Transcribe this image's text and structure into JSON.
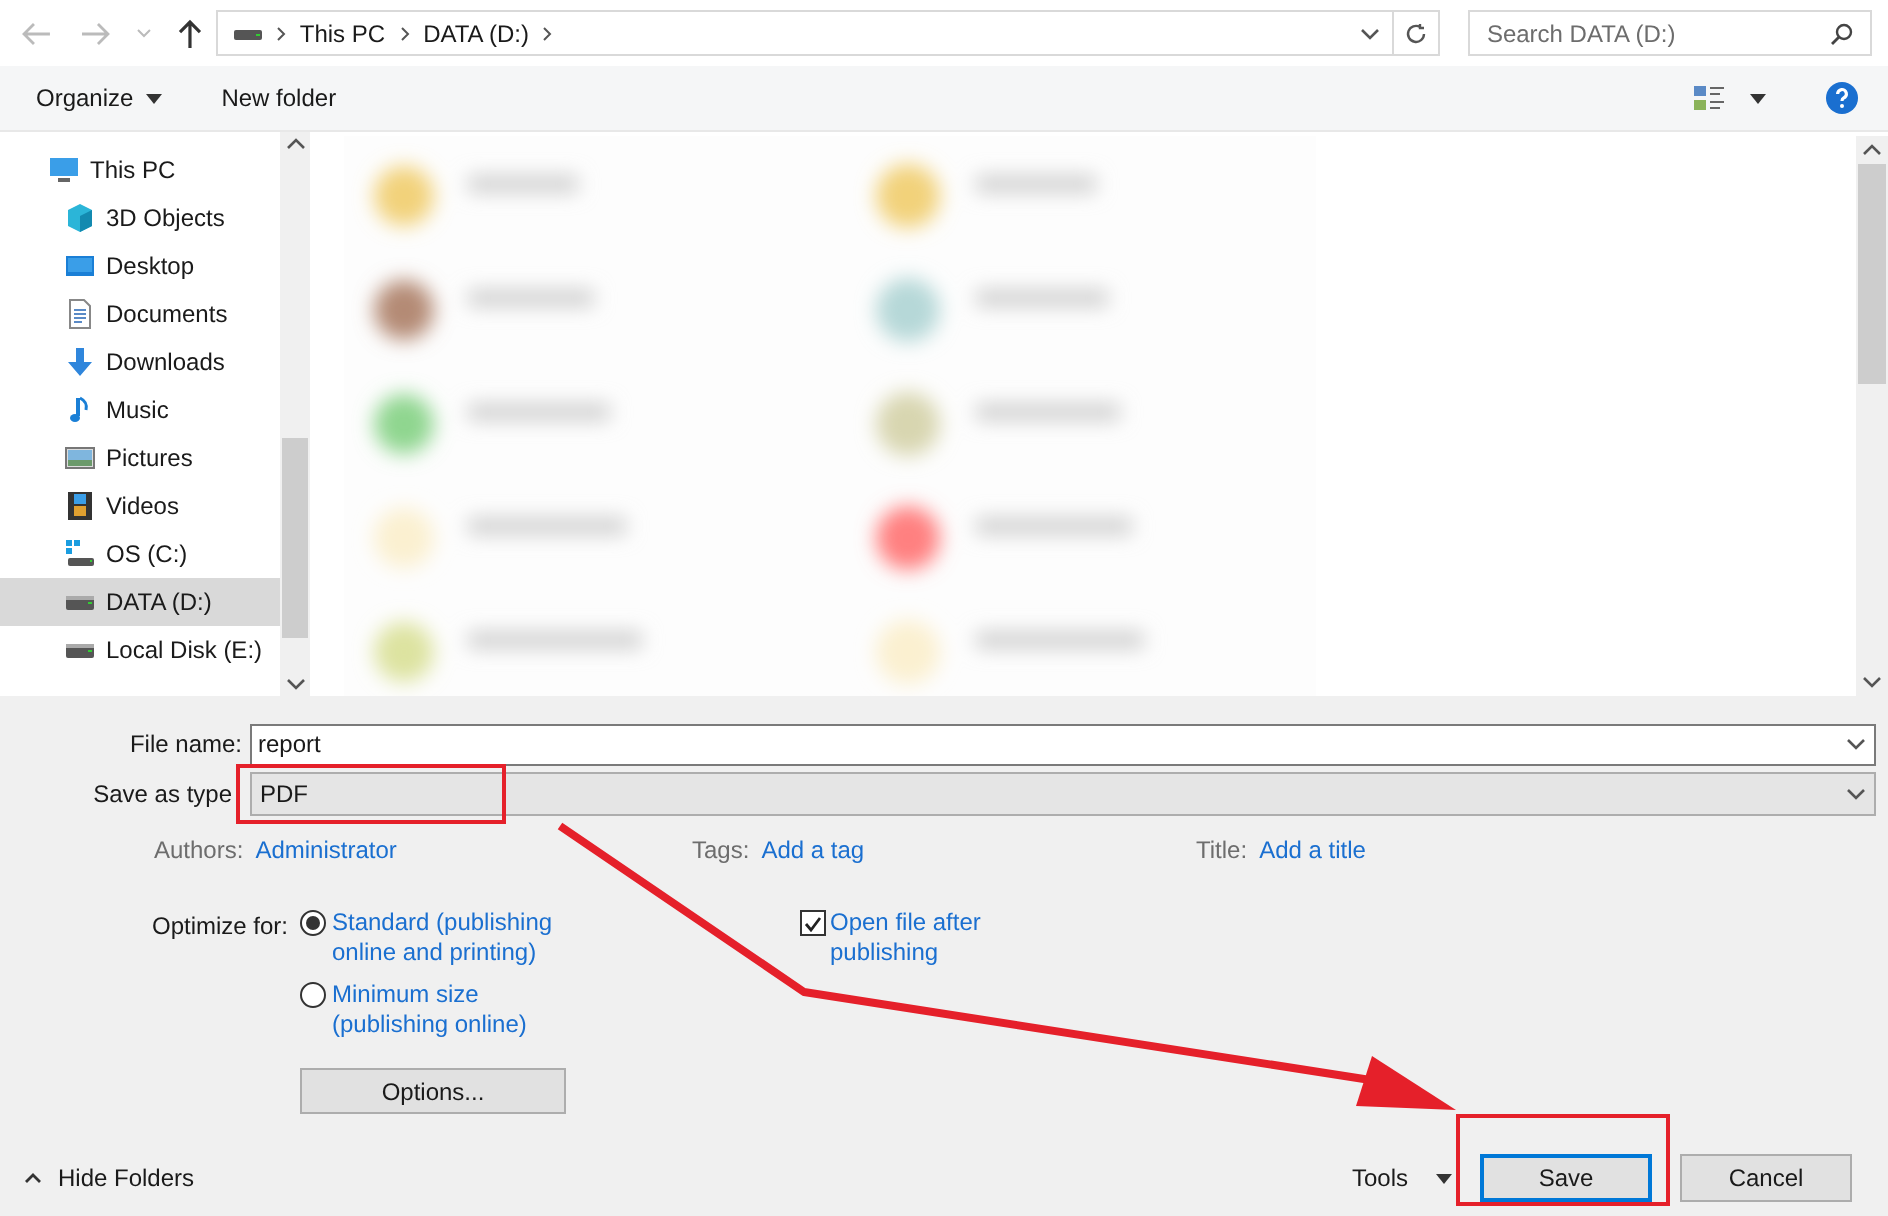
{
  "address_bar": {
    "path": [
      "This PC",
      "DATA (D:)"
    ]
  },
  "search": {
    "placeholder": "Search DATA (D:)"
  },
  "toolbar": {
    "organize": "Organize",
    "new_folder": "New folder"
  },
  "sidebar": {
    "items": [
      {
        "label": "This PC",
        "kind": "pc",
        "selected": false
      },
      {
        "label": "3D Objects",
        "kind": "cube",
        "selected": false
      },
      {
        "label": "Desktop",
        "kind": "desktop",
        "selected": false
      },
      {
        "label": "Documents",
        "kind": "documents",
        "selected": false
      },
      {
        "label": "Downloads",
        "kind": "downloads",
        "selected": false
      },
      {
        "label": "Music",
        "kind": "music",
        "selected": false
      },
      {
        "label": "Pictures",
        "kind": "pictures",
        "selected": false
      },
      {
        "label": "Videos",
        "kind": "videos",
        "selected": false
      },
      {
        "label": "OS (C:)",
        "kind": "os-drive",
        "selected": false
      },
      {
        "label": "DATA (D:)",
        "kind": "drive",
        "selected": true
      },
      {
        "label": "Local Disk (E:)",
        "kind": "drive",
        "selected": false
      }
    ]
  },
  "file_name": {
    "label": "File name:",
    "value": "report"
  },
  "save_as_type": {
    "label": "Save as type",
    "value": "PDF"
  },
  "metadata": [
    {
      "label": "Authors:",
      "value": "Administrator"
    },
    {
      "label": "Tags:",
      "value": "Add a tag"
    },
    {
      "label": "Title:",
      "value": "Add a title"
    }
  ],
  "optimize": {
    "label": "Optimize for:",
    "options": [
      {
        "label": "Standard (publishing online and printing)",
        "selected": true
      },
      {
        "label": "Minimum size (publishing online)",
        "selected": false
      }
    ]
  },
  "options_button": "Options...",
  "open_after": {
    "label": "Open file after publishing",
    "checked": true
  },
  "hide_folders": "Hide Folders",
  "tools": "Tools",
  "save": "Save",
  "cancel": "Cancel"
}
